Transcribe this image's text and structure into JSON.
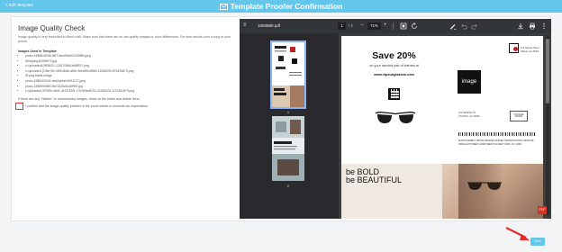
{
  "header": {
    "back_link": "< Edit Template",
    "title": "Template Proofer Confirmation",
    "icon": "template-icon",
    "background": "#63c7ec"
  },
  "main": {
    "title": "Image Quality Check",
    "intro": "Image quality is very important in direct mail. Make sure that there are no low quality images or color differences. For best results print a copy of your proofs.",
    "images_heading": "Images Used In Template",
    "images": [
      "photo-1556818238-0f6716ec96eb0243f388.jpeg",
      "Shopping15498071.jpg",
      "c=uploaded1(9f05021-1261706f61b6f8927.png",
      "c=uploaded-[7d4e7d1-4f96-8b4b-af5e-3ebc89c4f8b0-1226f025-0f76193873.png",
      "IR.png-blank-image",
      "photo-1585403244-dea2abbeb2b91127.jpeg",
      "photo-1568690863-9b01325c5c3d9f91.jpg",
      "c=uploaded-3f75f3e-dbd1-4e78-82f5-1753b0ed6191-11265025-1172461879.png"
    ],
    "hidden_note": "If there are any \"hidden\" or unnecessary images, return to the editor and delete them.",
    "confirm_label": "I confirm that the image quality present in the proof meets or exceeds our expectation."
  },
  "viewer": {
    "filename": "1003580.pdf",
    "page_current": "1",
    "page_total": "/ 2",
    "zoom": "71%",
    "thumbnail_labels": [
      "1",
      "2"
    ],
    "page1": {
      "headline": "Save 20%",
      "subline": "on your second pair of frames at",
      "site": "www.vipsunglasses.com",
      "image_tile": "image",
      "return_address": "123 Sample Street Atlanta, GA 30303",
      "mailer_address": "123 SAMPLE ST ATLANTA, GA 30303",
      "postage": "POSTAGE INDICIA",
      "recipient": "MONTGOMERY SMITH HASKINS UNITED STATES POSTAL SERVICE 3000 ELM STREET APARTMENT 5A NEW YORK, NY 10001",
      "bold_line1": "be BOLD",
      "bold_line2": "be BEAUTIFUL"
    },
    "badge": "PDF"
  },
  "footer": {
    "next_label": "Next"
  }
}
